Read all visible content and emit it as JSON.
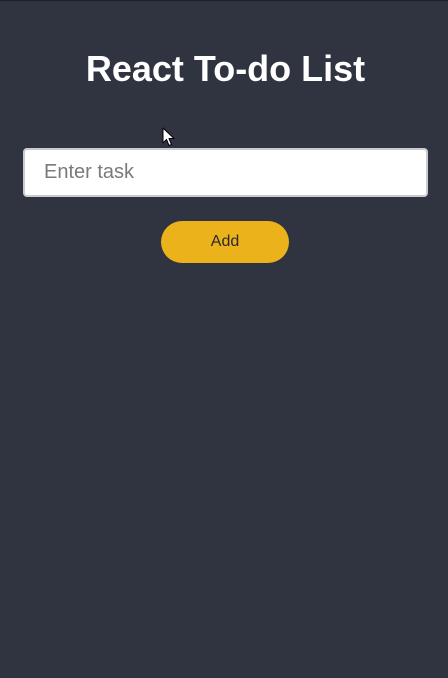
{
  "app": {
    "title": "React To-do List"
  },
  "input": {
    "value": "",
    "placeholder": "Enter task"
  },
  "add_button": {
    "label": "Add"
  },
  "colors": {
    "background": "#303441",
    "accent": "#ecb21b",
    "title_text": "#ffffff"
  },
  "icons": {
    "cursor": "mouse-pointer-icon"
  }
}
